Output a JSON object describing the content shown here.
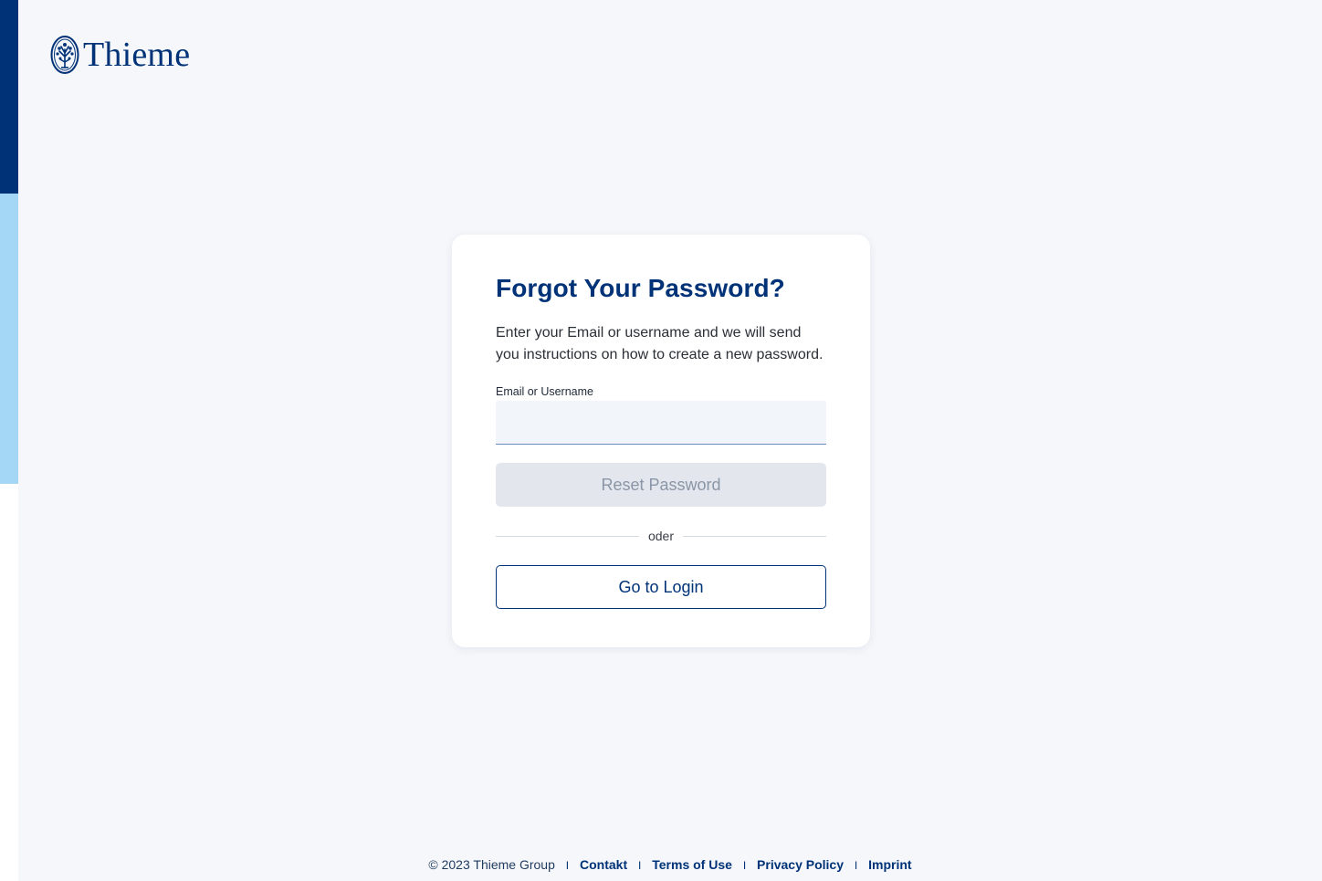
{
  "brand": {
    "logo_text": "Thieme",
    "colors": {
      "primary": "#003278",
      "accent_light": "#a4d6f5",
      "background": "#f5f7fa"
    },
    "logo_icon": "tree-seal-icon"
  },
  "card": {
    "title": "Forgot Your Password?",
    "description": "Enter your Email or username and we will send you instructions on how to create a new password.",
    "field_label": "Email or Username",
    "field_value": "",
    "reset_button_label": "Reset Password",
    "reset_button_state": "disabled",
    "divider_text": "oder",
    "login_button_label": "Go to Login"
  },
  "footer": {
    "copyright": "© 2023 Thieme Group",
    "separator": "I",
    "links": [
      "Contakt",
      "Terms of Use",
      "Privacy Policy",
      "Imprint"
    ]
  }
}
